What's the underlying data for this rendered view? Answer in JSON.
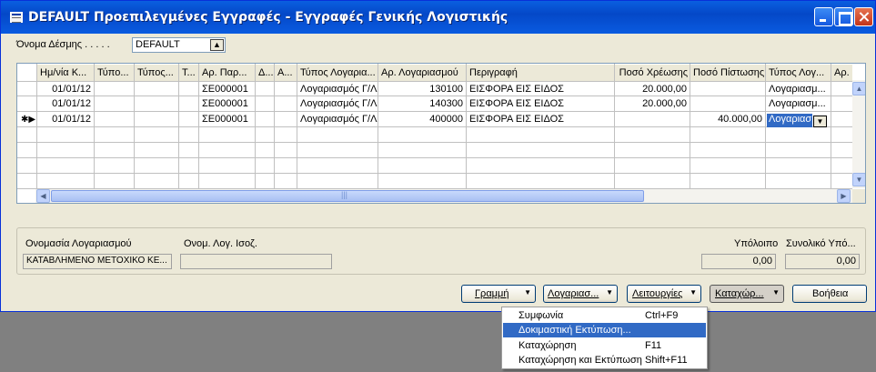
{
  "window": {
    "title": "DEFAULT Προεπιλεγμένες Εγγραφές - Εγγραφές Γενικής Λογιστικής",
    "accent": "#0a5be0"
  },
  "batch": {
    "label": "Όνομα Δέσμης . . . . .",
    "value": "DEFAULT"
  },
  "grid": {
    "columns": [
      "Ημ/νία Κ...",
      "Τύπο...",
      "Τύπος...",
      "Τ...",
      "Αρ. Παρ...",
      "Δ...",
      "Α...",
      "Τύπος Λογαρια...",
      "Αρ. Λογαριασμού",
      "Περιγραφή",
      "Ποσό Χρέωσης",
      "Ποσό Πίστωσης",
      "Τύπος Λογ...",
      "Αρ."
    ],
    "rows": [
      [
        "01/01/12",
        "",
        "",
        "",
        "ΣΕ000001",
        "",
        "",
        "Λογαριασμός Γ/Λ",
        "130100",
        "ΕΙΣΦΟΡΑ ΕΙΣ ΕΙΔΟΣ",
        "20.000,00",
        "",
        "Λογαριασμ...",
        ""
      ],
      [
        "01/01/12",
        "",
        "",
        "",
        "ΣΕ000001",
        "",
        "",
        "Λογαριασμός Γ/Λ",
        "140300",
        "ΕΙΣΦΟΡΑ ΕΙΣ ΕΙΔΟΣ",
        "20.000,00",
        "",
        "Λογαριασμ...",
        ""
      ],
      [
        "01/01/12",
        "",
        "",
        "",
        "ΣΕ000001",
        "",
        "",
        "Λογαριασμός Γ/Λ",
        "400000",
        "ΕΙΣΦΟΡΑ ΕΙΣ ΕΙΔΟΣ",
        "",
        "40.000,00",
        "Λογαριασ",
        ""
      ]
    ],
    "current_row_marker": "✱▶"
  },
  "footer": {
    "account_name_label": "Ονομασία Λογαριασμού",
    "account_name_value": "ΚΑΤΑΒΛΗΜΕΝΟ ΜΕΤΟΧΙΚΟ ΚΕ...",
    "balancing_label": "Ονομ. Λογ. Ισοζ.",
    "balancing_value": "",
    "balance_label": "Υπόλοιπο",
    "balance_value": "0,00",
    "total_balance_label": "Συνολικό Υπό...",
    "total_balance_value": "0,00"
  },
  "buttons": {
    "line": "Γραμμή",
    "account": "Λογαριασ...",
    "functions": "Λειτουργίες",
    "posting": "Καταχώρ...",
    "help": "Βοήθεια"
  },
  "menu": {
    "items": [
      {
        "label": "Συμφωνία",
        "shortcut": "Ctrl+F9"
      },
      {
        "label": "Δοκιμαστική Εκτύπωση...",
        "shortcut": ""
      },
      {
        "label": "Καταχώρηση",
        "shortcut": "F11"
      },
      {
        "label": "Καταχώρηση και Εκτύπωση",
        "shortcut": "Shift+F11"
      }
    ],
    "highlighted_index": 1
  }
}
